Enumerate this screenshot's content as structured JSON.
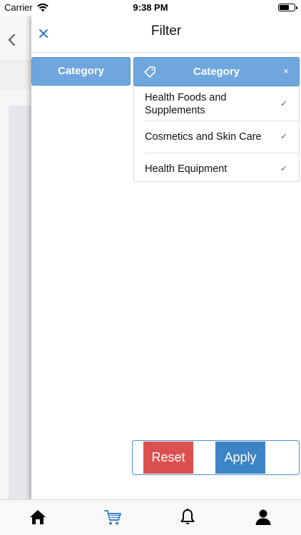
{
  "status_bar": {
    "carrier": "Carrier",
    "time": "9:38 PM",
    "wifi_icon": "wifi-icon",
    "battery_icon": "battery-icon"
  },
  "background_page": {
    "back_icon": "chevron-left-icon"
  },
  "filter": {
    "title": "Filter",
    "close_icon": "close-icon",
    "category_button_label": "Category",
    "dropdown": {
      "label": "Category",
      "tag_icon": "tag-icon",
      "clear_label": "×",
      "items": [
        {
          "label": "Health Foods and Supplements",
          "check": "✓"
        },
        {
          "label": "Cosmetics and Skin Care",
          "check": "✓"
        },
        {
          "label": "Health Equipment",
          "check": "✓"
        }
      ]
    },
    "reset_label": "Reset",
    "apply_label": "Apply"
  },
  "tabbar": {
    "items": [
      {
        "name": "home",
        "icon": "home-icon",
        "color": "#000000"
      },
      {
        "name": "cart",
        "icon": "cart-icon",
        "color": "#3d84c6"
      },
      {
        "name": "notifications",
        "icon": "bell-icon",
        "color": "#000000"
      },
      {
        "name": "profile",
        "icon": "user-icon",
        "color": "#000000"
      }
    ]
  },
  "colors": {
    "accent": "#6ea6dd",
    "apply": "#3d84c6",
    "reset": "#dc5050"
  }
}
